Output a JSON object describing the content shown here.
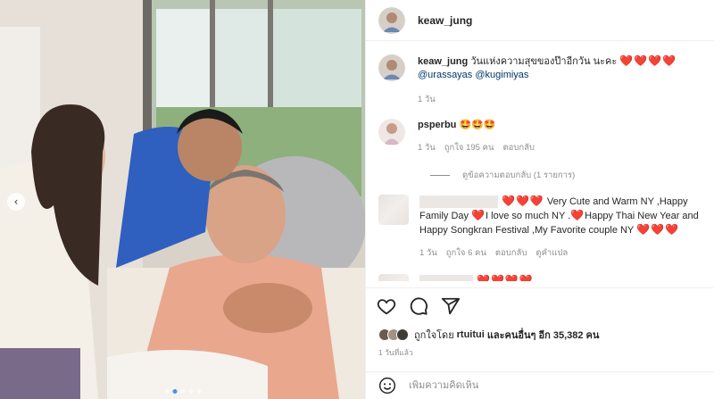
{
  "post": {
    "username": "keaw_jung"
  },
  "caption": {
    "username": "keaw_jung",
    "text": "วันแห่งความสุขของป๊าอีกวัน นะคะ",
    "hearts": "❤️❤️❤️❤️",
    "mentions": "@urassayas @kugimiyas",
    "time": "1 วัน"
  },
  "comments": [
    {
      "username": "psperbu",
      "text": "🤩🤩🤩",
      "time": "1 วัน",
      "likes": "ถูกใจ 195 คน",
      "reply": "ตอบกลับ",
      "view_replies": "ดูข้อความตอบกลับ (1 รายการ)"
    },
    {
      "text_a": "Very Cute and Warm NY ,Happy Family Day",
      "text_b": "I love so much NY .",
      "text_c": "Happy Thai New Year and Happy Songkran Festival ,My Favorite couple NY",
      "time": "1 วัน",
      "likes": "ถูกใจ 6 คน",
      "reply": "ตอบกลับ",
      "translate": "ดูคำแปล"
    }
  ],
  "likes_line": {
    "prefix": "ถูกใจโดย",
    "user": "rtuitui",
    "suffix": "และคนอื่นๆ อีก 35,382 คน"
  },
  "posted_ago": "1 วันที่แล้ว",
  "composer": {
    "placeholder": "เพิ่มความคิดเห็น"
  },
  "colors": {
    "heart": "#ed4956",
    "mention": "#00376b",
    "carousel_active": "#4a90e2"
  },
  "icons": [
    "heart-icon",
    "comment-icon",
    "share-icon",
    "emoji-icon",
    "chevron-left-icon"
  ]
}
